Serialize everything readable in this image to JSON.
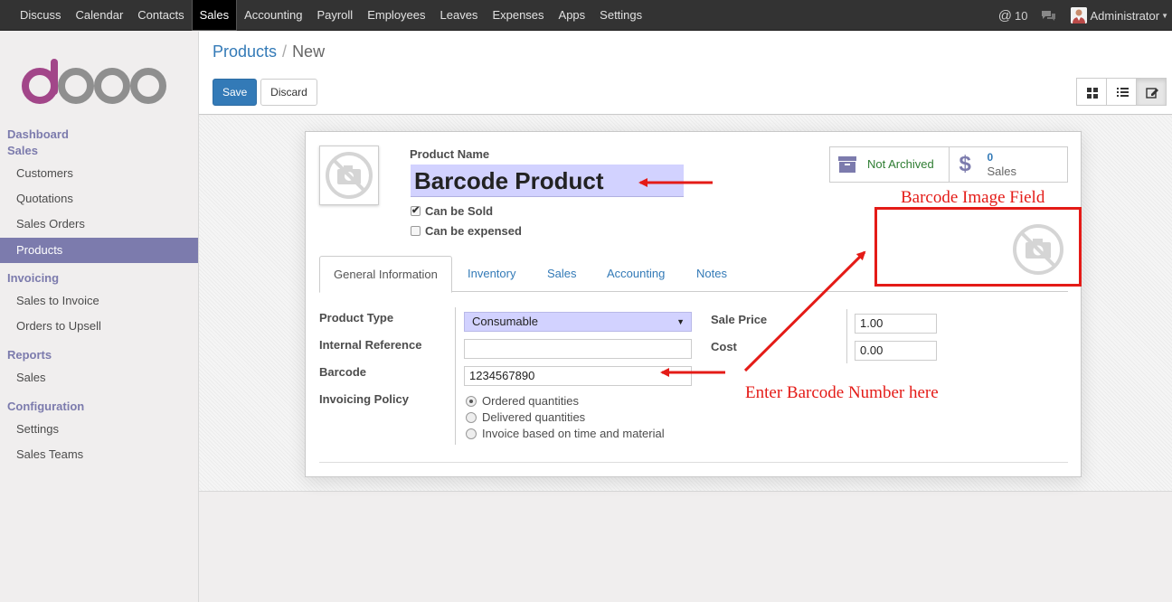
{
  "topbar": {
    "menu": [
      "Discuss",
      "Calendar",
      "Contacts",
      "Sales",
      "Accounting",
      "Payroll",
      "Employees",
      "Leaves",
      "Expenses",
      "Apps",
      "Settings"
    ],
    "active": "Sales",
    "mentions": "10",
    "user": "Administrator"
  },
  "sidebar": {
    "dashboard": "Dashboard",
    "sales_section": "Sales",
    "sales_items": [
      "Customers",
      "Quotations",
      "Sales Orders",
      "Products"
    ],
    "active_item": "Products",
    "invoicing_section": "Invoicing",
    "invoicing_items": [
      "Sales to Invoice",
      "Orders to Upsell"
    ],
    "reports_section": "Reports",
    "reports_items": [
      "Sales"
    ],
    "config_section": "Configuration",
    "config_items": [
      "Settings",
      "Sales Teams"
    ]
  },
  "breadcrumb": {
    "parent": "Products",
    "separator": "/",
    "current": "New"
  },
  "buttons": {
    "save": "Save",
    "discard": "Discard"
  },
  "form": {
    "product_name_label": "Product Name",
    "product_name": "Barcode Product",
    "can_be_sold": "Can be Sold",
    "can_be_sold_checked": true,
    "can_be_expensed": "Can be expensed",
    "can_be_expensed_checked": false,
    "stat_archive": "Not Archived",
    "stat_sales_count": "0",
    "stat_sales_label": "Sales",
    "tabs": [
      "General Information",
      "Inventory",
      "Sales",
      "Accounting",
      "Notes"
    ],
    "active_tab": "General Information",
    "product_type_label": "Product Type",
    "product_type": "Consumable",
    "internal_reference_label": "Internal Reference",
    "internal_reference": "",
    "barcode_label": "Barcode",
    "barcode": "1234567890",
    "invoicing_policy_label": "Invoicing Policy",
    "invoicing_options": [
      "Ordered quantities",
      "Delivered quantities",
      "Invoice based on time and material"
    ],
    "invoicing_selected": "Ordered quantities",
    "sale_price_label": "Sale Price",
    "sale_price": "1.00",
    "cost_label": "Cost",
    "cost": "0.00"
  },
  "annotations": {
    "barcode_image": "Barcode Image Field",
    "enter_barcode": "Enter Barcode Number here",
    "color": "#e41b17"
  },
  "colors": {
    "brand_purple": "#7c7bad",
    "primary": "#337ab7",
    "required_field": "#d2d2ff",
    "navbar": "#333333"
  }
}
